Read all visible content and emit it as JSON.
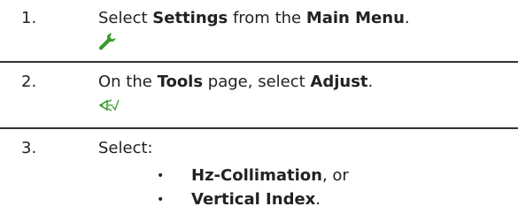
{
  "steps": [
    {
      "number": "1.",
      "parts": [
        "Select ",
        "Settings",
        " from the ",
        "Main Menu",
        "."
      ],
      "icon": "wrench-icon",
      "icon_color": "#3a9a2e"
    },
    {
      "number": "2.",
      "parts": [
        "On the ",
        "Tools",
        " page, select ",
        "Adjust",
        "."
      ],
      "icon": "adjust-icon",
      "icon_color": "#3a9a2e"
    },
    {
      "number": "3.",
      "text": "Select:",
      "bullets": [
        {
          "bold": "Hz-Collimation",
          "rest": ", or"
        },
        {
          "bold": "Vertical Index",
          "rest": "."
        }
      ],
      "bullet_char": "•"
    }
  ],
  "colors": {
    "text": "#222222",
    "divider": "#333333",
    "icon_green": "#3a9a2e"
  }
}
